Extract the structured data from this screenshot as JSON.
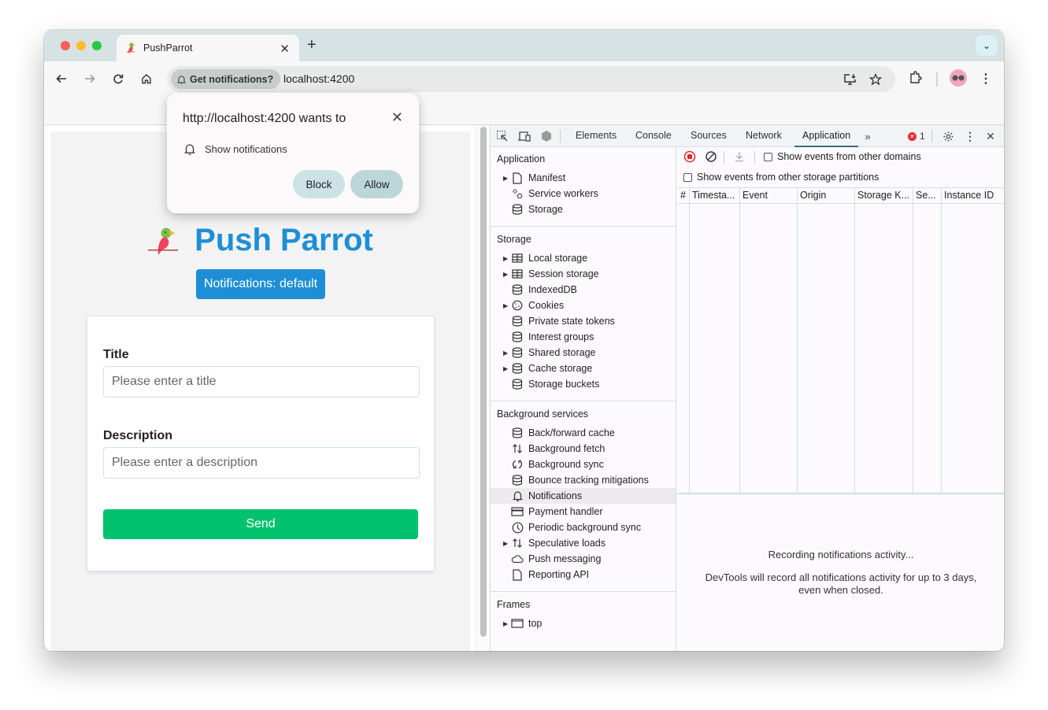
{
  "browser": {
    "tab": {
      "title": "PushParrot"
    },
    "url": "localhost:4200",
    "permission_chip": "Get notifications?"
  },
  "popup": {
    "title": "http://localhost:4200 wants to",
    "permission": "Show notifications",
    "block_label": "Block",
    "allow_label": "Allow"
  },
  "app": {
    "title": "Push Parrot",
    "status": "Notifications: default",
    "form": {
      "title_label": "Title",
      "title_placeholder": "Please enter a title",
      "title_value": "",
      "description_label": "Description",
      "description_placeholder": "Please enter a description",
      "description_value": "",
      "send_label": "Send"
    },
    "colors": {
      "primary": "#1e8fd6",
      "send": "#00c26e"
    }
  },
  "devtools": {
    "tabs": [
      {
        "label": "Elements",
        "active": false
      },
      {
        "label": "Console",
        "active": false
      },
      {
        "label": "Sources",
        "active": false
      },
      {
        "label": "Network",
        "active": false
      },
      {
        "label": "Application",
        "active": true
      }
    ],
    "error_count": "1",
    "sidebar": {
      "sections": [
        {
          "title": "Application",
          "items": [
            {
              "label": "Manifest",
              "icon": "file-icon",
              "expandable": true
            },
            {
              "label": "Service workers",
              "icon": "gears-icon",
              "expandable": false
            },
            {
              "label": "Storage",
              "icon": "database-icon",
              "expandable": false
            }
          ]
        },
        {
          "title": "Storage",
          "items": [
            {
              "label": "Local storage",
              "icon": "table-icon",
              "expandable": true
            },
            {
              "label": "Session storage",
              "icon": "table-icon",
              "expandable": true
            },
            {
              "label": "IndexedDB",
              "icon": "database-icon",
              "expandable": false
            },
            {
              "label": "Cookies",
              "icon": "cookie-icon",
              "expandable": true
            },
            {
              "label": "Private state tokens",
              "icon": "database-icon",
              "expandable": false
            },
            {
              "label": "Interest groups",
              "icon": "database-icon",
              "expandable": false
            },
            {
              "label": "Shared storage",
              "icon": "database-icon",
              "expandable": true
            },
            {
              "label": "Cache storage",
              "icon": "database-icon",
              "expandable": true
            },
            {
              "label": "Storage buckets",
              "icon": "database-icon",
              "expandable": false
            }
          ]
        },
        {
          "title": "Background services",
          "items": [
            {
              "label": "Back/forward cache",
              "icon": "database-icon",
              "expandable": false
            },
            {
              "label": "Background fetch",
              "icon": "arrows-updown-icon",
              "expandable": false
            },
            {
              "label": "Background sync",
              "icon": "sync-icon",
              "expandable": false
            },
            {
              "label": "Bounce tracking mitigations",
              "icon": "database-icon",
              "expandable": false
            },
            {
              "label": "Notifications",
              "icon": "bell-icon",
              "expandable": false,
              "selected": true
            },
            {
              "label": "Payment handler",
              "icon": "card-icon",
              "expandable": false
            },
            {
              "label": "Periodic background sync",
              "icon": "clock-icon",
              "expandable": false
            },
            {
              "label": "Speculative loads",
              "icon": "arrows-updown-icon",
              "expandable": true
            },
            {
              "label": "Push messaging",
              "icon": "cloud-icon",
              "expandable": false
            },
            {
              "label": "Reporting API",
              "icon": "file-icon",
              "expandable": false
            }
          ]
        },
        {
          "title": "Frames",
          "items": [
            {
              "label": "top",
              "icon": "frame-icon",
              "expandable": true
            }
          ]
        }
      ]
    },
    "main": {
      "checkbox_domains": {
        "label": "Show events from other domains",
        "checked": false
      },
      "checkbox_partitions": {
        "label": "Show events from other storage partitions",
        "checked": false
      },
      "columns": [
        "#",
        "Timesta...",
        "Event",
        "Origin",
        "Storage K...",
        "Se...",
        "Instance ID"
      ],
      "rows": [],
      "recording_msg": "Recording notifications activity...",
      "info_msg_line1": "DevTools will record all notifications activity for up to 3 days,",
      "info_msg_line2": "even when closed."
    }
  }
}
